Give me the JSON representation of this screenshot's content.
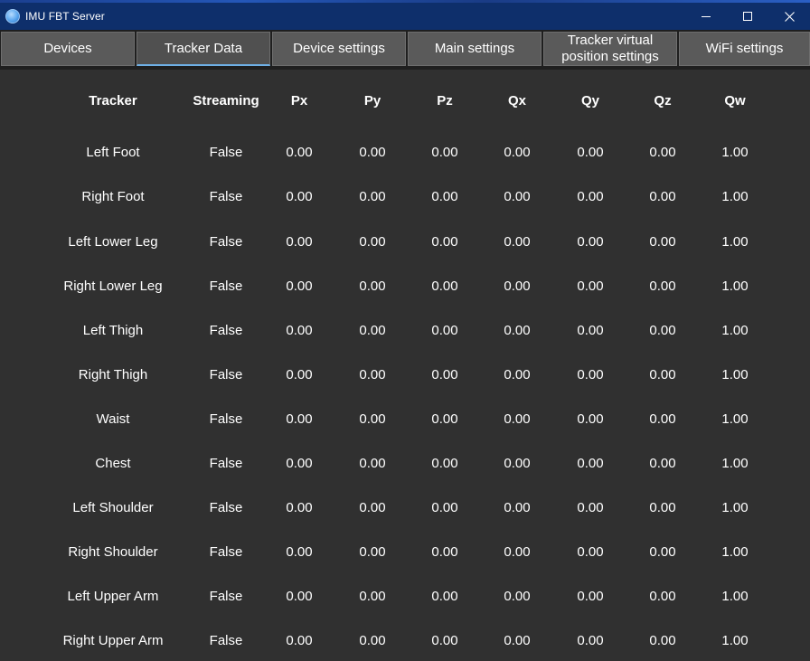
{
  "window": {
    "title": "IMU FBT Server",
    "icon": "app-globe-icon",
    "controls": [
      "minimize-icon",
      "maximize-icon",
      "close-icon"
    ]
  },
  "tabs": [
    {
      "label": "Devices",
      "active": false
    },
    {
      "label": "Tracker Data",
      "active": true
    },
    {
      "label": "Device settings",
      "active": false
    },
    {
      "label": "Main settings",
      "active": false
    },
    {
      "label": "Tracker virtual position settings",
      "active": false
    },
    {
      "label": "WiFi settings",
      "active": false
    }
  ],
  "table": {
    "columns": [
      "Tracker",
      "Streaming",
      "Px",
      "Py",
      "Pz",
      "Qx",
      "Qy",
      "Qz",
      "Qw"
    ],
    "rows": [
      [
        "Left Foot",
        "False",
        "0.00",
        "0.00",
        "0.00",
        "0.00",
        "0.00",
        "0.00",
        "1.00"
      ],
      [
        "Right Foot",
        "False",
        "0.00",
        "0.00",
        "0.00",
        "0.00",
        "0.00",
        "0.00",
        "1.00"
      ],
      [
        "Left Lower Leg",
        "False",
        "0.00",
        "0.00",
        "0.00",
        "0.00",
        "0.00",
        "0.00",
        "1.00"
      ],
      [
        "Right Lower Leg",
        "False",
        "0.00",
        "0.00",
        "0.00",
        "0.00",
        "0.00",
        "0.00",
        "1.00"
      ],
      [
        "Left Thigh",
        "False",
        "0.00",
        "0.00",
        "0.00",
        "0.00",
        "0.00",
        "0.00",
        "1.00"
      ],
      [
        "Right Thigh",
        "False",
        "0.00",
        "0.00",
        "0.00",
        "0.00",
        "0.00",
        "0.00",
        "1.00"
      ],
      [
        "Waist",
        "False",
        "0.00",
        "0.00",
        "0.00",
        "0.00",
        "0.00",
        "0.00",
        "1.00"
      ],
      [
        "Chest",
        "False",
        "0.00",
        "0.00",
        "0.00",
        "0.00",
        "0.00",
        "0.00",
        "1.00"
      ],
      [
        "Left Shoulder",
        "False",
        "0.00",
        "0.00",
        "0.00",
        "0.00",
        "0.00",
        "0.00",
        "1.00"
      ],
      [
        "Right Shoulder",
        "False",
        "0.00",
        "0.00",
        "0.00",
        "0.00",
        "0.00",
        "0.00",
        "1.00"
      ],
      [
        "Left Upper Arm",
        "False",
        "0.00",
        "0.00",
        "0.00",
        "0.00",
        "0.00",
        "0.00",
        "1.00"
      ],
      [
        "Right Upper Arm",
        "False",
        "0.00",
        "0.00",
        "0.00",
        "0.00",
        "0.00",
        "0.00",
        "1.00"
      ]
    ]
  },
  "colors": {
    "titlebar": "#0e2f6b",
    "tab_bg": "#5a5a5a",
    "active_indicator": "#6fb0e6",
    "content_bg": "#303030",
    "text": "#ffffff"
  }
}
